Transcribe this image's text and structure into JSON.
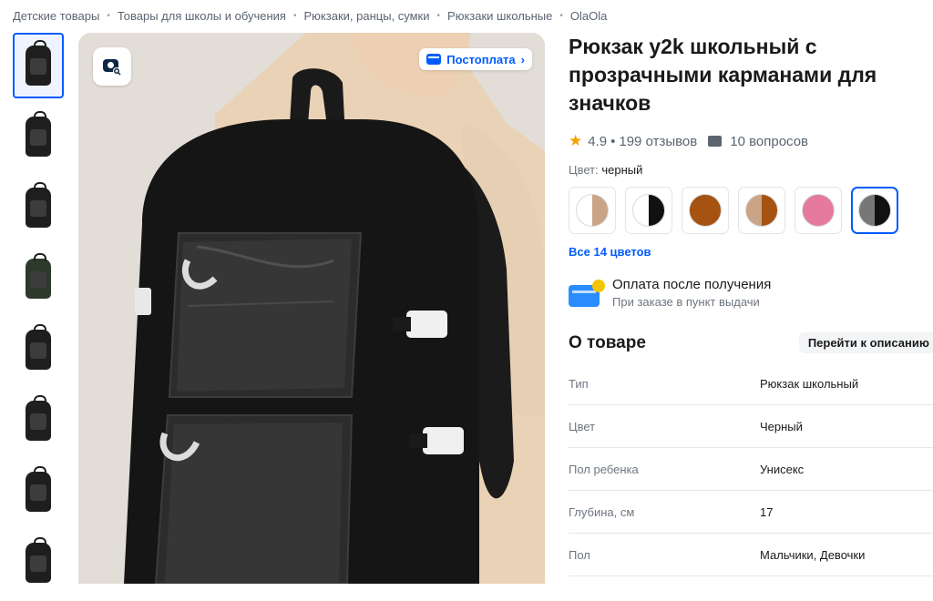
{
  "breadcrumb": [
    "Детские товары",
    "Товары для школы и обучения",
    "Рюкзаки, ранцы, сумки",
    "Рюкзаки школьные",
    "OlaOla"
  ],
  "gallery": {
    "thumb_count": 8,
    "active_index": 0,
    "postpay_label": "Постоплата"
  },
  "product": {
    "title": "Рюкзак y2k школьный с прозрачными карманами для значков",
    "rating": "4.9",
    "reviews": "199 отзывов",
    "questions": "10 вопросов",
    "color_label": "Цвет:",
    "color_value": "черный",
    "swatches": [
      {
        "name": "beige-white",
        "colors": [
          "#ffffff",
          "#c9a486"
        ]
      },
      {
        "name": "white-black",
        "colors": [
          "#ffffff",
          "#111111"
        ]
      },
      {
        "name": "brown",
        "colors": [
          "#a65210",
          "#a65210"
        ]
      },
      {
        "name": "brown-mix",
        "colors": [
          "#c9a486",
          "#a65210"
        ]
      },
      {
        "name": "pink",
        "colors": [
          "#e6799e",
          "#e6799e"
        ]
      },
      {
        "name": "black",
        "colors": [
          "#777777",
          "#111111"
        ]
      }
    ],
    "active_swatch": 5,
    "all_colors": "Все 14 цветов"
  },
  "payment": {
    "title": "Оплата после получения",
    "subtitle": "При заказе в пункт выдачи"
  },
  "about": {
    "heading": "О товаре",
    "goto": "Перейти к описанию",
    "rows": [
      {
        "k": "Тип",
        "v": "Рюкзак школьный"
      },
      {
        "k": "Цвет",
        "v": "Черный"
      },
      {
        "k": "Пол ребенка",
        "v": "Унисекс"
      },
      {
        "k": "Глубина, см",
        "v": "17"
      },
      {
        "k": "Пол",
        "v": "Мальчики, Девочки"
      }
    ]
  },
  "colors": {
    "accent": "#005bff",
    "star": "#f5a000",
    "text": "#1a1a1a",
    "muted": "#6e7680"
  }
}
